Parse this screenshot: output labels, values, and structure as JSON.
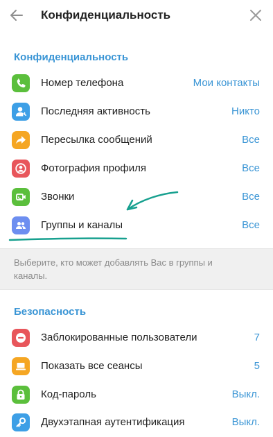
{
  "header": {
    "title": "Конфиденциальность"
  },
  "icons": {
    "back": "arrow-left-icon",
    "close": "close-icon"
  },
  "privacy": {
    "section_title": "Конфиденциальность",
    "items": [
      {
        "label": "Номер телефона",
        "value": "Мои контакты",
        "icon": "phone-icon",
        "color": "#5bbf3c"
      },
      {
        "label": "Последняя активность",
        "value": "Никто",
        "icon": "person-icon",
        "color": "#3d9fe6"
      },
      {
        "label": "Пересылка сообщений",
        "value": "Все",
        "icon": "forward-icon",
        "color": "#f5a623"
      },
      {
        "label": "Фотография профиля",
        "value": "Все",
        "icon": "profile-photo-icon",
        "color": "#e8565b"
      },
      {
        "label": "Звонки",
        "value": "Все",
        "icon": "video-call-icon",
        "color": "#5bbf3c"
      },
      {
        "label": "Группы и каналы",
        "value": "Все",
        "icon": "group-icon",
        "color": "#6d8ef0"
      }
    ],
    "hint": "Выберите, кто может добавлять Вас в группы и каналы."
  },
  "security": {
    "section_title": "Безопасность",
    "items": [
      {
        "label": "Заблокированные пользователи",
        "value": "7",
        "icon": "blocked-icon",
        "color": "#e8565b"
      },
      {
        "label": "Показать все сеансы",
        "value": "5",
        "icon": "laptop-icon",
        "color": "#f5a623"
      },
      {
        "label": "Код-пароль",
        "value": "Выкл.",
        "icon": "lock-icon",
        "color": "#5bbf3c"
      },
      {
        "label": "Двухэтапная аутентификация",
        "value": "Выкл.",
        "icon": "key-icon",
        "color": "#3d9fe6"
      }
    ]
  },
  "colors": {
    "accent": "#3a95d5",
    "annotation": "#17a08f"
  }
}
